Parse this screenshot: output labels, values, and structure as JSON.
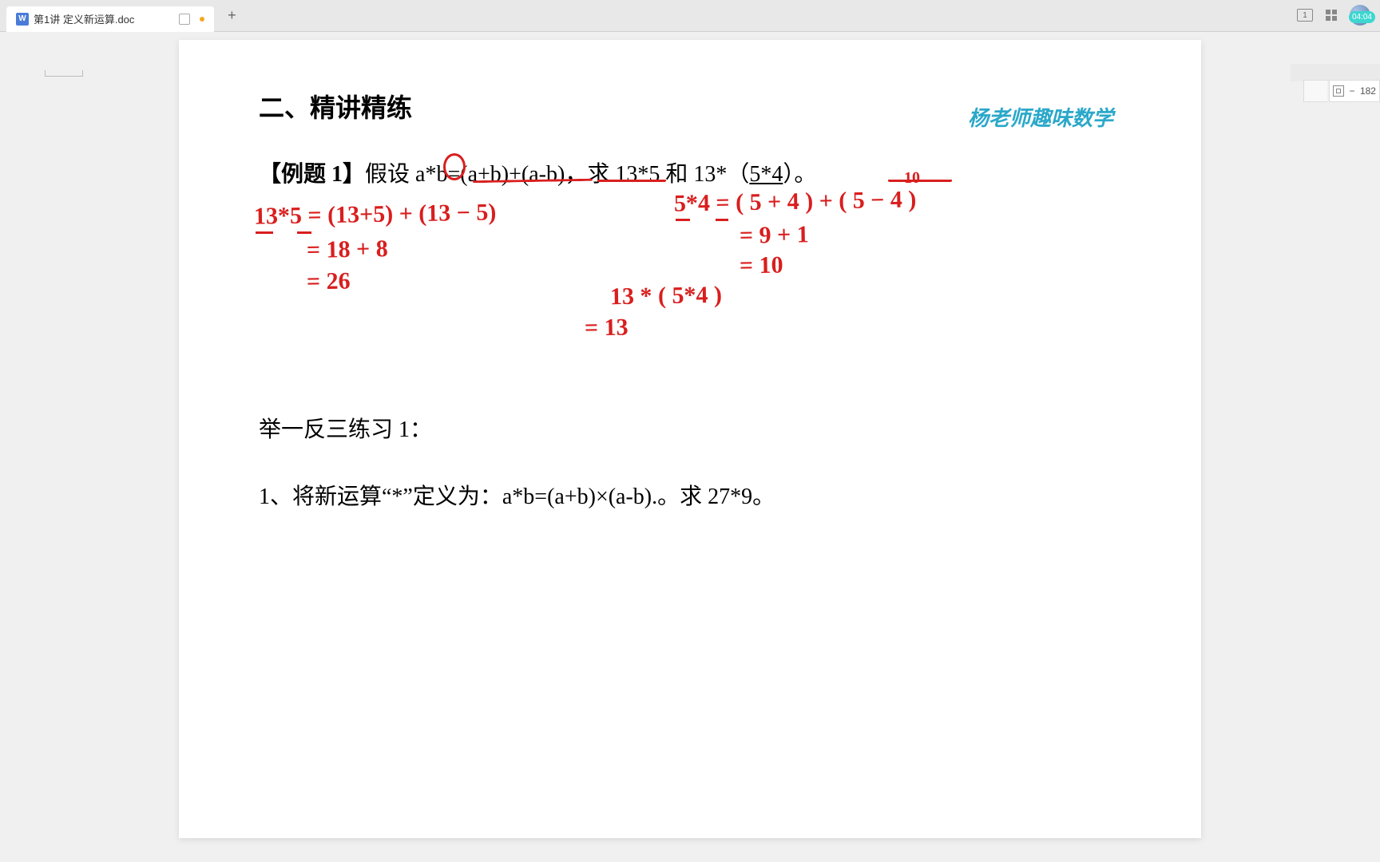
{
  "tab": {
    "title": "第1讲 定义新运算.doc",
    "add_label": "+"
  },
  "header_icons": {
    "layout": "1",
    "apps": "apps",
    "avatar": "user"
  },
  "timestamp": "04:04",
  "zoom": {
    "minus": "−",
    "value": "182"
  },
  "doc": {
    "section_heading": "二、精讲精练",
    "watermark": "杨老师趣味数学",
    "example_label": "【例题 1】",
    "example_body_1": "假设 ",
    "example_formula": "a*b=(a+b)+(a-b)",
    "example_body_2": "，求 13*5 和 13*（",
    "example_paren": "5*4",
    "example_body_3": "）。",
    "practice_heading": "举一反三练习 1：",
    "practice_q1": "1、将新运算“*”定义为：a*b=(a+b)×(a-b).。求 27*9。"
  },
  "handwriting": {
    "left1": "13*5 = (13+5) + (13 − 5)",
    "left2": "= 18 + 8",
    "left3": "= 26",
    "right1": "5*4 = ( 5 + 4 ) + ( 5 − 4 )",
    "right1_sup": "10",
    "right2": "= 9 + 1",
    "right3": "= 10",
    "mid1": "13 * ( 5*4 )",
    "mid2": "= 13"
  }
}
